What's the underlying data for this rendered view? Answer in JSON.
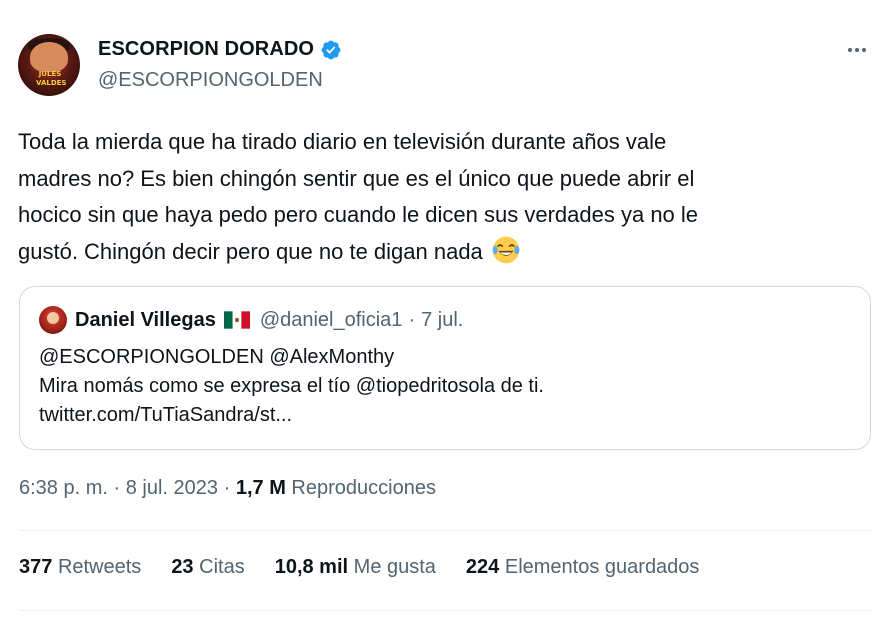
{
  "author": {
    "display_name": "ESCORPION DORADO",
    "handle": "@ESCORPIONGOLDEN",
    "avatar_text": "JULES VALDES",
    "verified": true,
    "verified_color": "#1d9bf0"
  },
  "tweet": {
    "text": "Toda la mierda que ha tirado diario en televisión durante años vale madres no? Es bien chingón sentir que es el único que puede abrir el hocico sin que haya pedo pero cuando le dicen sus verdades ya no le gustó. Chingón decir pero que no te digan nada",
    "lines": [
      "Toda la mierda que ha tirado diario en televisión durante años vale",
      "madres no? Es bien chingón sentir que es el único que puede abrir el",
      "hocico sin que haya pedo pero cuando le dicen sus verdades ya no le",
      "gustó. Chingón decir pero que no te digan nada"
    ],
    "emoji": "face-with-tears-of-joy-icon"
  },
  "quote": {
    "name": "Daniel Villegas",
    "flag": "mexico-flag-icon",
    "handle": "@daniel_oficia1",
    "separator": "·",
    "date": "7 jul.",
    "lines": [
      "@ESCORPIONGOLDEN @AlexMonthy",
      "Mira nomás como se expresa el tío @tiopedritosola de ti.",
      "twitter.com/TuTiaSandra/st..."
    ]
  },
  "meta": {
    "time": "6:38 p. m.",
    "sep1": "·",
    "date": "8 jul. 2023",
    "sep2": "·",
    "views_count": "1,7 M",
    "views_label": "Reproducciones"
  },
  "stats": [
    {
      "count": "377",
      "label": "Retweets"
    },
    {
      "count": "23",
      "label": "Citas"
    },
    {
      "count": "10,8 mil",
      "label": "Me gusta"
    },
    {
      "count": "224",
      "label": "Elementos guardados"
    }
  ],
  "colors": {
    "text_primary": "#0f1419",
    "text_secondary": "#536471",
    "border": "#cfd9de",
    "divider": "#eff3f4"
  }
}
